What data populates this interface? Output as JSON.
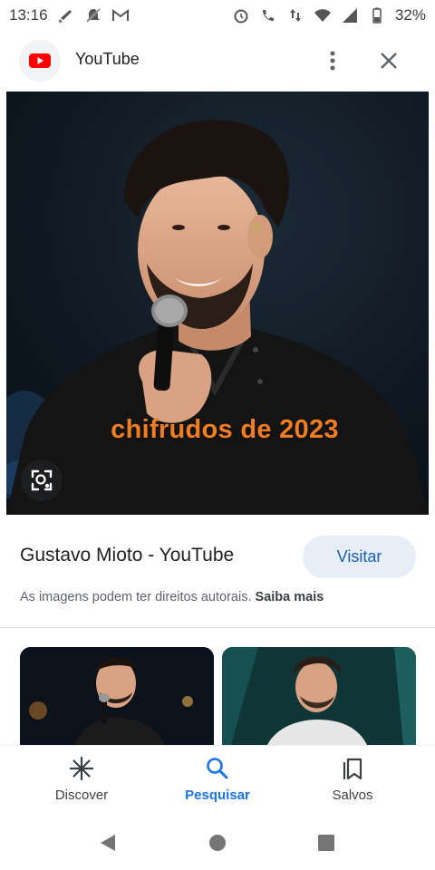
{
  "status_bar": {
    "time": "13:16",
    "battery_percent": "32%",
    "left_icons": [
      "broom-icon",
      "notifications-off-icon",
      "gmail-icon"
    ],
    "right_icons": [
      "alarm-icon",
      "wifi-calling-icon",
      "data-arrows-icon",
      "wifi-icon",
      "cell-signal-icon",
      "battery-icon"
    ]
  },
  "header": {
    "site_name": "YouTube",
    "icons": {
      "logo": "youtube-logo-icon",
      "more": "more-vert-icon",
      "close": "close-icon"
    }
  },
  "image": {
    "overlay_text": "chifrudos de 2023"
  },
  "result": {
    "title": "Gustavo Mioto - YouTube",
    "visit_label": "Visitar",
    "copyright_text": "As imagens podem ter direitos autorais.",
    "learn_more": "Saiba mais"
  },
  "bottom_nav": {
    "items": [
      {
        "label": "Discover",
        "icon": "asterisk-icon"
      },
      {
        "label": "Pesquisar",
        "icon": "search-icon",
        "active": true
      },
      {
        "label": "Salvos",
        "icon": "bookmarks-icon"
      }
    ]
  },
  "colors": {
    "accent": "#1a73e8",
    "visit_button_bg": "#e8eef8",
    "overlay_text": "#f07d22",
    "youtube_red": "#ff0000"
  }
}
